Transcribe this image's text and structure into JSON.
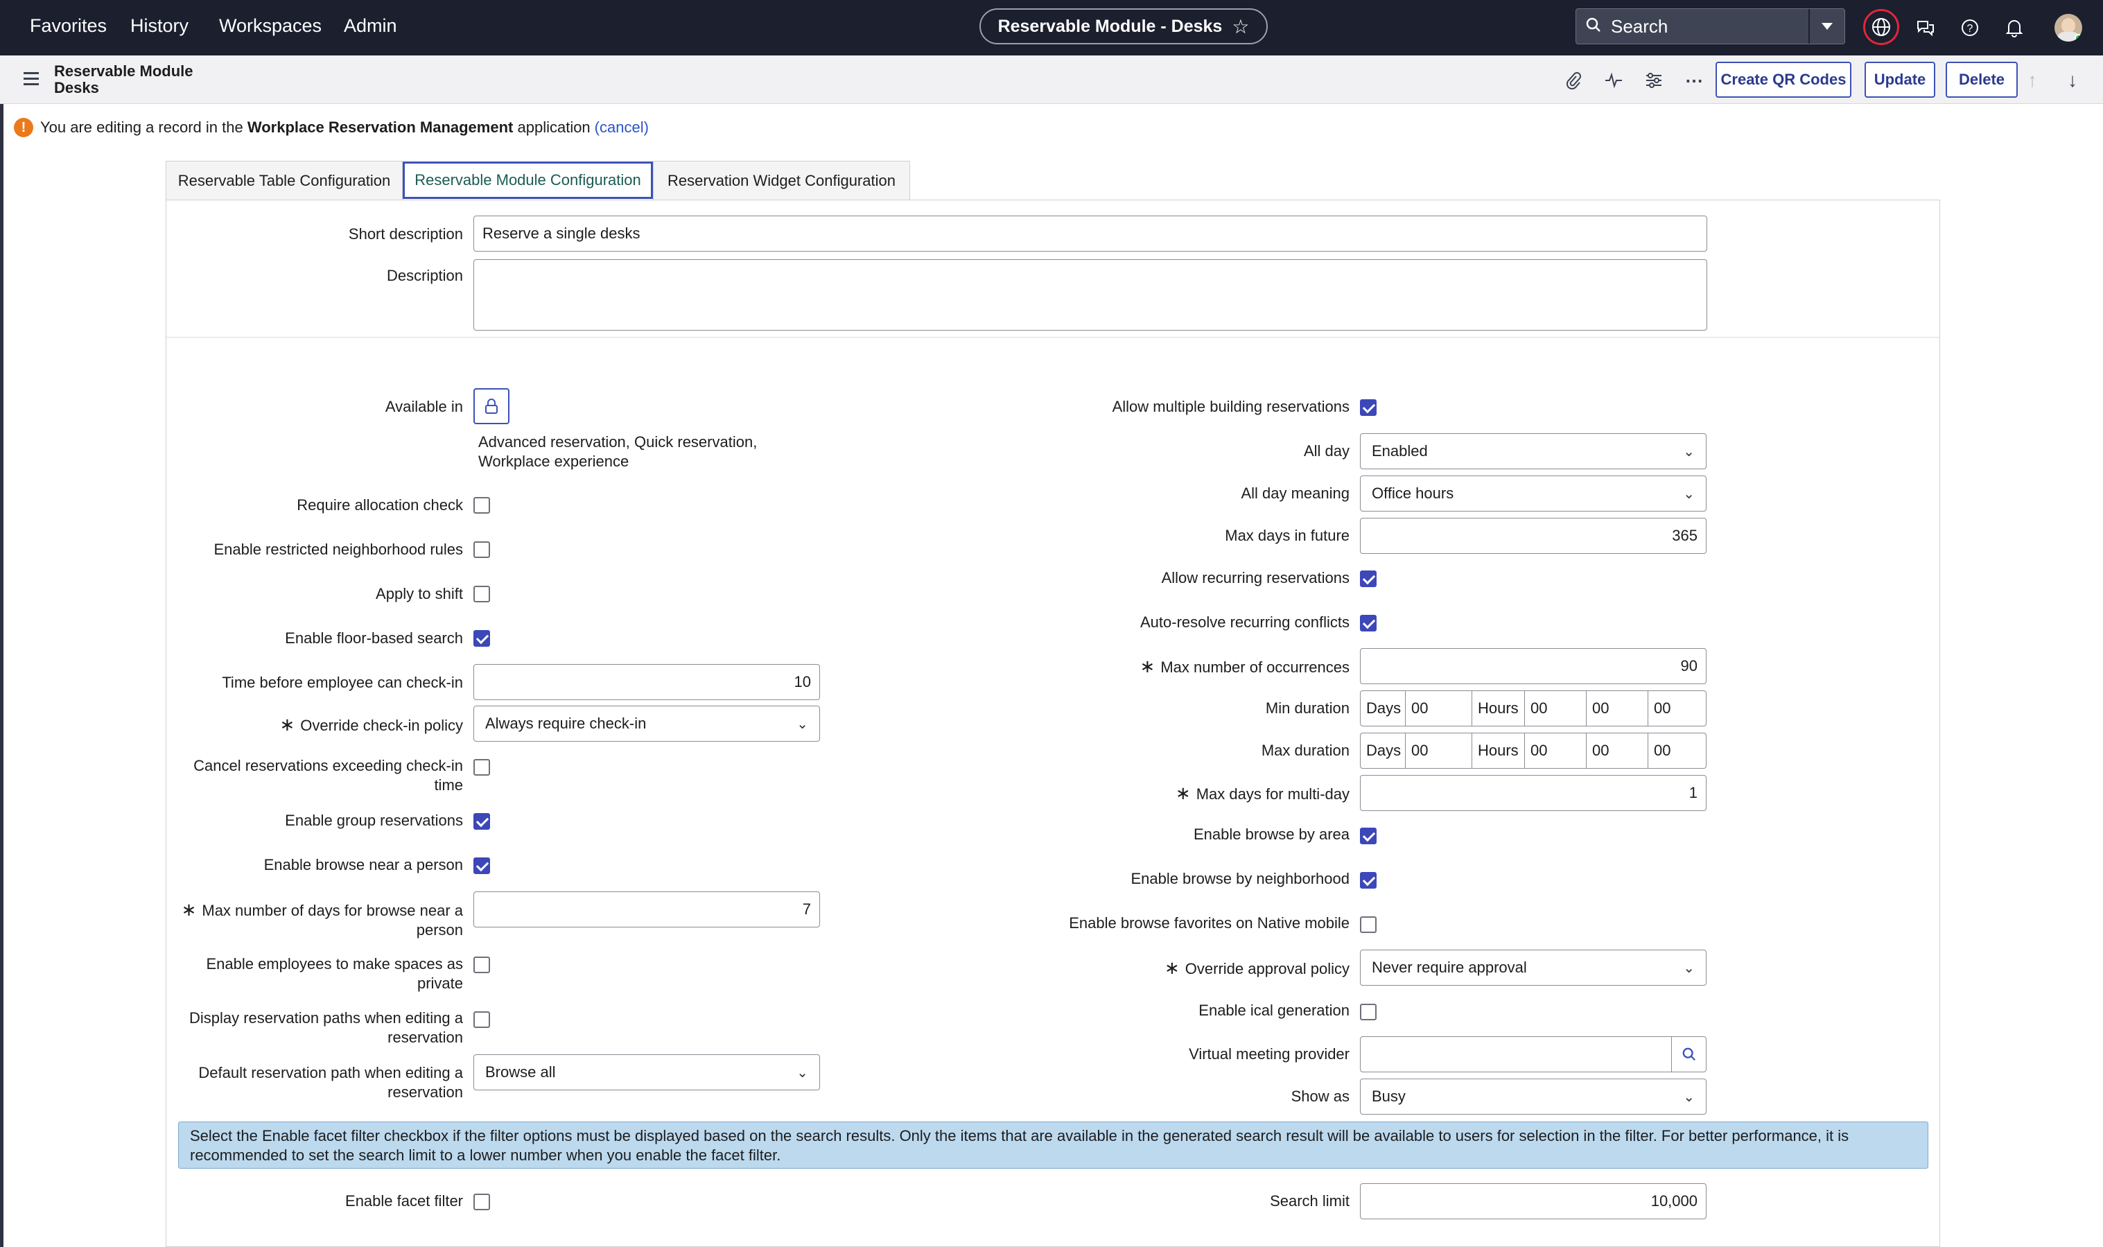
{
  "topnav": {
    "menu": [
      "Favorites",
      "History",
      "Workspaces",
      "Admin"
    ],
    "record_title": "Reservable Module - Desks",
    "search_label": "Search"
  },
  "header": {
    "title_line1": "Reservable Module",
    "title_line2": "Desks",
    "buttons": {
      "qr": "Create QR Codes",
      "update": "Update",
      "delete": "Delete"
    }
  },
  "notice": {
    "prefix": "You are editing a record in the",
    "app": "Workplace Reservation Management",
    "suffix": "application",
    "cancel": "(cancel)"
  },
  "tabs": [
    "Reservable Table Configuration",
    "Reservable Module Configuration",
    "Reservation Widget Configuration"
  ],
  "top_fields": {
    "short_description_label": "Short description",
    "short_description_value": "Reserve a single desks",
    "description_label": "Description",
    "description_value": ""
  },
  "left": {
    "available_in_label": "Available in",
    "available_in_value": "Advanced reservation, Quick reservation, Workplace experience",
    "require_allocation_check": {
      "label": "Require allocation check",
      "checked": false
    },
    "enable_restricted_neighborhood": {
      "label": "Enable restricted neighborhood rules",
      "checked": false
    },
    "apply_to_shift": {
      "label": "Apply to shift",
      "checked": false
    },
    "enable_floor_search": {
      "label": "Enable floor-based search",
      "checked": true
    },
    "time_before_checkin": {
      "label": "Time before employee can check-in",
      "value": "10"
    },
    "override_checkin": {
      "label": "Override check-in policy",
      "value": "Always require check-in"
    },
    "cancel_exceeding": {
      "label_1": "Cancel reservations exceeding check-in",
      "label_2": "time",
      "checked": false
    },
    "enable_group": {
      "label": "Enable group reservations",
      "checked": true
    },
    "enable_browse_person": {
      "label": "Enable browse near a person",
      "checked": true
    },
    "max_days_browse": {
      "label_1": "Max number of days for browse near a",
      "label_2": "person",
      "value": "7"
    },
    "enable_private": {
      "label_1": "Enable employees to make spaces as",
      "label_2": "private",
      "checked": false
    },
    "display_paths": {
      "label_1": "Display reservation paths when editing a",
      "label_2": "reservation",
      "checked": false
    },
    "default_path": {
      "label_1": "Default reservation path when editing a",
      "label_2": "reservation",
      "value": "Browse all"
    }
  },
  "right": {
    "allow_multi_building": {
      "label": "Allow multiple building reservations",
      "checked": true
    },
    "all_day": {
      "label": "All day",
      "value": "Enabled"
    },
    "all_day_meaning": {
      "label": "All day meaning",
      "value": "Office hours"
    },
    "max_days_future": {
      "label": "Max days in future",
      "value": "365"
    },
    "allow_recurring": {
      "label": "Allow recurring reservations",
      "checked": true
    },
    "auto_resolve": {
      "label": "Auto-resolve recurring conflicts",
      "checked": true
    },
    "max_occurrences": {
      "label": "Max number of occurrences",
      "value": "90"
    },
    "min_duration": {
      "label": "Min duration",
      "days_label": "Days",
      "days": "00",
      "hours_label": "Hours",
      "hours": "00",
      "minutes": "00",
      "seconds": "00"
    },
    "max_duration": {
      "label": "Max duration",
      "days_label": "Days",
      "days": "00",
      "hours_label": "Hours",
      "hours": "00",
      "minutes": "00",
      "seconds": "00"
    },
    "max_days_multiday": {
      "label": "Max days for multi-day",
      "value": "1"
    },
    "browse_area": {
      "label": "Enable browse by area",
      "checked": true
    },
    "browse_neighborhood": {
      "label": "Enable browse by neighborhood",
      "checked": true
    },
    "browse_favorites": {
      "label": "Enable browse favorites on Native mobile",
      "checked": false
    },
    "override_approval": {
      "label": "Override approval policy",
      "value": "Never require approval"
    },
    "enable_ical": {
      "label": "Enable ical generation",
      "checked": false
    },
    "virtual_meeting": {
      "label": "Virtual meeting provider",
      "value": ""
    },
    "show_as": {
      "label": "Show as",
      "value": "Busy"
    }
  },
  "info_text_1": "Select the Enable facet filter checkbox if the filter options must be displayed based on the search results. Only the items that are available in the generated search result will be available to users for selection in the filter. For better performance, it is",
  "info_text_2": "recommended to set the search limit to a lower number when you enable the facet filter.",
  "bottom": {
    "facet_filter": {
      "label": "Enable facet filter",
      "checked": false
    },
    "search_limit": {
      "label": "Search limit",
      "value": "10,000"
    }
  },
  "required_marker": "∗",
  "colors": {
    "nav_bg": "#1b1f2e",
    "accent": "#3c52b8",
    "checkbox_checked": "#3c47b8",
    "info_bg": "#bcd9ee",
    "warning": "#ea7a1b"
  }
}
